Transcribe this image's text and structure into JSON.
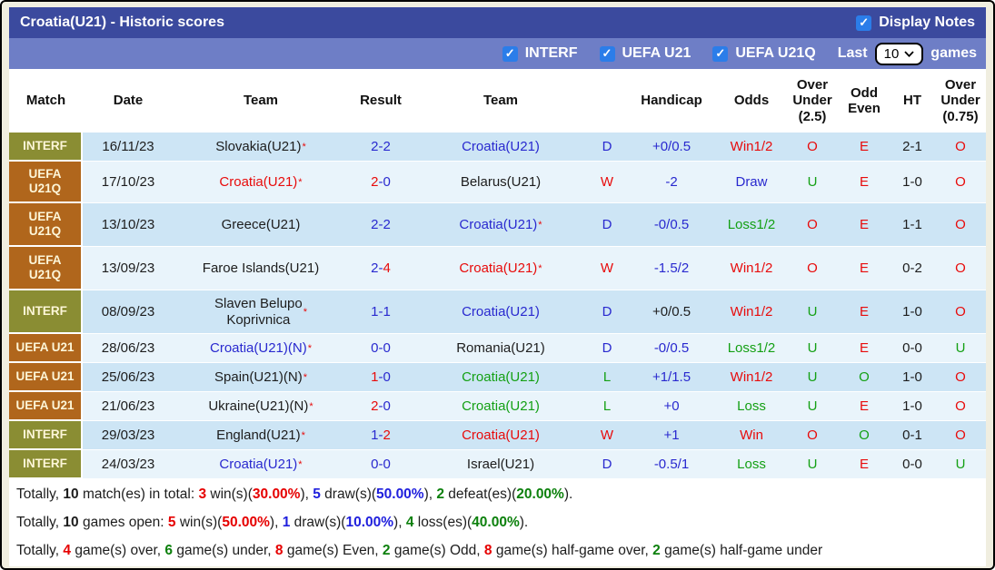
{
  "palette": {
    "bar1": "#3b4a9e",
    "bar2": "#6e7ec6",
    "beige": "#f0eee0",
    "row_dark": "#cde5f5",
    "row_light": "#e9f4fb",
    "olive": "#8a8d33",
    "brown": "#b0661c",
    "badge_text": "#fdf6d8",
    "red": "#e80b0b",
    "blue": "#2929cf",
    "green": "#14a014",
    "black": "#1d1d1d",
    "sum_red": "#e60000",
    "sum_blue": "#2020dd",
    "sum_green": "#0c800c",
    "checkbox_blue": "#2b7de9"
  },
  "icons": {
    "check": "✓",
    "star": "*"
  },
  "header": {
    "title": "Croatia(U21) - Historic scores",
    "display_notes_label": "Display Notes",
    "display_notes_checked": true
  },
  "filters": {
    "competitions": [
      {
        "label": "INTERF",
        "checked": true
      },
      {
        "label": "UEFA U21",
        "checked": true
      },
      {
        "label": "UEFA U21Q",
        "checked": true
      }
    ],
    "last_label": "Last",
    "last_value": "10",
    "games_label": "games"
  },
  "table": {
    "columns": [
      "Match",
      "Date",
      "Team",
      "Result",
      "Team",
      "",
      "Handicap",
      "Odds",
      "Over\nUnder\n(2.5)",
      "Odd\nEven",
      "HT",
      "Over\nUnder\n(0.75)"
    ],
    "rows": [
      {
        "comp": "INTERF",
        "comp_lines": "INTERF",
        "comp_color": "olive",
        "h": 32,
        "shade": "dark",
        "date": "16/11/23",
        "home": {
          "name": "Slovakia(U21)",
          "color": "black",
          "star": true
        },
        "score": [
          [
            "2",
            "blue"
          ],
          [
            "-",
            "blue"
          ],
          [
            "2",
            "blue"
          ]
        ],
        "away": {
          "name": "Croatia(U21)",
          "color": "blue",
          "star": false
        },
        "wdl": [
          "D",
          "blue"
        ],
        "handicap": [
          "+0/0.5",
          "blue"
        ],
        "odds": [
          "Win1/2",
          "red"
        ],
        "ou25": [
          "O",
          "red"
        ],
        "oe": [
          "E",
          "red"
        ],
        "ht": "2-1",
        "ou075": [
          "O",
          "red"
        ]
      },
      {
        "comp": "UEFA U21Q",
        "comp_lines": "UEFA\nU21Q",
        "comp_color": "brown",
        "h": 46,
        "shade": "light",
        "date": "17/10/23",
        "home": {
          "name": "Croatia(U21)",
          "color": "red",
          "star": true
        },
        "score": [
          [
            "2",
            "red"
          ],
          [
            "-",
            "blue"
          ],
          [
            "0",
            "blue"
          ]
        ],
        "away": {
          "name": "Belarus(U21)",
          "color": "black",
          "star": false
        },
        "wdl": [
          "W",
          "red"
        ],
        "handicap": [
          "-2",
          "blue"
        ],
        "odds": [
          "Draw",
          "blue"
        ],
        "ou25": [
          "U",
          "green"
        ],
        "oe": [
          "E",
          "red"
        ],
        "ht": "1-0",
        "ou075": [
          "O",
          "red"
        ]
      },
      {
        "comp": "UEFA U21Q",
        "comp_lines": "UEFA\nU21Q",
        "comp_color": "brown",
        "h": 48,
        "shade": "dark",
        "date": "13/10/23",
        "home": {
          "name": "Greece(U21)",
          "color": "black",
          "star": false
        },
        "score": [
          [
            "2",
            "blue"
          ],
          [
            "-",
            "blue"
          ],
          [
            "2",
            "blue"
          ]
        ],
        "away": {
          "name": "Croatia(U21)",
          "color": "blue",
          "star": true
        },
        "wdl": [
          "D",
          "blue"
        ],
        "handicap": [
          "-0/0.5",
          "blue"
        ],
        "odds": [
          "Loss1/2",
          "green"
        ],
        "ou25": [
          "O",
          "red"
        ],
        "oe": [
          "E",
          "red"
        ],
        "ht": "1-1",
        "ou075": [
          "O",
          "red"
        ]
      },
      {
        "comp": "UEFA U21Q",
        "comp_lines": "UEFA\nU21Q",
        "comp_color": "brown",
        "h": 48,
        "shade": "light",
        "date": "13/09/23",
        "home": {
          "name": "Faroe Islands(U21)",
          "color": "black",
          "star": false
        },
        "score": [
          [
            "2",
            "blue"
          ],
          [
            "-",
            "blue"
          ],
          [
            "4",
            "red"
          ]
        ],
        "away": {
          "name": "Croatia(U21)",
          "color": "red",
          "star": true
        },
        "wdl": [
          "W",
          "red"
        ],
        "handicap": [
          "-1.5/2",
          "blue"
        ],
        "odds": [
          "Win1/2",
          "red"
        ],
        "ou25": [
          "O",
          "red"
        ],
        "oe": [
          "E",
          "red"
        ],
        "ht": "0-2",
        "ou075": [
          "O",
          "red"
        ]
      },
      {
        "comp": "INTERF",
        "comp_lines": "INTERF",
        "comp_color": "olive",
        "h": 48,
        "shade": "dark",
        "date": "08/09/23",
        "home": {
          "name": "Slaven Belupo\nKoprivnica",
          "color": "black",
          "star": true
        },
        "score": [
          [
            "1",
            "blue"
          ],
          [
            "-",
            "blue"
          ],
          [
            "1",
            "blue"
          ]
        ],
        "away": {
          "name": "Croatia(U21)",
          "color": "blue",
          "star": false
        },
        "wdl": [
          "D",
          "blue"
        ],
        "handicap": [
          "+0/0.5",
          "black"
        ],
        "odds": [
          "Win1/2",
          "red"
        ],
        "ou25": [
          "U",
          "green"
        ],
        "oe": [
          "E",
          "red"
        ],
        "ht": "1-0",
        "ou075": [
          "O",
          "red"
        ]
      },
      {
        "comp": "UEFA U21",
        "comp_lines": "UEFA U21",
        "comp_color": "brown",
        "h": 32,
        "shade": "light",
        "date": "28/06/23",
        "home": {
          "name": "Croatia(U21)(N)",
          "color": "blue",
          "star": true
        },
        "score": [
          [
            "0",
            "blue"
          ],
          [
            "-",
            "blue"
          ],
          [
            "0",
            "blue"
          ]
        ],
        "away": {
          "name": "Romania(U21)",
          "color": "black",
          "star": false
        },
        "wdl": [
          "D",
          "blue"
        ],
        "handicap": [
          "-0/0.5",
          "blue"
        ],
        "odds": [
          "Loss1/2",
          "green"
        ],
        "ou25": [
          "U",
          "green"
        ],
        "oe": [
          "E",
          "red"
        ],
        "ht": "0-0",
        "ou075": [
          "U",
          "green"
        ]
      },
      {
        "comp": "UEFA U21",
        "comp_lines": "UEFA U21",
        "comp_color": "brown",
        "h": 32,
        "shade": "dark",
        "date": "25/06/23",
        "home": {
          "name": "Spain(U21)(N)",
          "color": "black",
          "star": true
        },
        "score": [
          [
            "1",
            "red"
          ],
          [
            "-",
            "blue"
          ],
          [
            "0",
            "blue"
          ]
        ],
        "away": {
          "name": "Croatia(U21)",
          "color": "green",
          "star": false
        },
        "wdl": [
          "L",
          "green"
        ],
        "handicap": [
          "+1/1.5",
          "blue"
        ],
        "odds": [
          "Win1/2",
          "red"
        ],
        "ou25": [
          "U",
          "green"
        ],
        "oe": [
          "O",
          "green"
        ],
        "ht": "1-0",
        "ou075": [
          "O",
          "red"
        ]
      },
      {
        "comp": "UEFA U21",
        "comp_lines": "UEFA U21",
        "comp_color": "brown",
        "h": 32,
        "shade": "light",
        "date": "21/06/23",
        "home": {
          "name": "Ukraine(U21)(N)",
          "color": "black",
          "star": true
        },
        "score": [
          [
            "2",
            "red"
          ],
          [
            "-",
            "blue"
          ],
          [
            "0",
            "blue"
          ]
        ],
        "away": {
          "name": "Croatia(U21)",
          "color": "green",
          "star": false
        },
        "wdl": [
          "L",
          "green"
        ],
        "handicap": [
          "+0",
          "blue"
        ],
        "odds": [
          "Loss",
          "green"
        ],
        "ou25": [
          "U",
          "green"
        ],
        "oe": [
          "E",
          "red"
        ],
        "ht": "1-0",
        "ou075": [
          "O",
          "red"
        ]
      },
      {
        "comp": "INTERF",
        "comp_lines": "INTERF",
        "comp_color": "olive",
        "h": 32,
        "shade": "dark",
        "date": "29/03/23",
        "home": {
          "name": "England(U21)",
          "color": "black",
          "star": true
        },
        "score": [
          [
            "1",
            "blue"
          ],
          [
            "-",
            "blue"
          ],
          [
            "2",
            "red"
          ]
        ],
        "away": {
          "name": "Croatia(U21)",
          "color": "red",
          "star": false
        },
        "wdl": [
          "W",
          "red"
        ],
        "handicap": [
          "+1",
          "blue"
        ],
        "odds": [
          "Win",
          "red"
        ],
        "ou25": [
          "O",
          "red"
        ],
        "oe": [
          "O",
          "green"
        ],
        "ht": "0-1",
        "ou075": [
          "O",
          "red"
        ]
      },
      {
        "comp": "INTERF",
        "comp_lines": "INTERF",
        "comp_color": "olive",
        "h": 32,
        "shade": "light",
        "date": "24/03/23",
        "home": {
          "name": "Croatia(U21)",
          "color": "blue",
          "star": true
        },
        "score": [
          [
            "0",
            "blue"
          ],
          [
            "-",
            "blue"
          ],
          [
            "0",
            "blue"
          ]
        ],
        "away": {
          "name": "Israel(U21)",
          "color": "black",
          "star": false
        },
        "wdl": [
          "D",
          "blue"
        ],
        "handicap": [
          "-0.5/1",
          "blue"
        ],
        "odds": [
          "Loss",
          "green"
        ],
        "ou25": [
          "U",
          "green"
        ],
        "oe": [
          "E",
          "red"
        ],
        "ht": "0-0",
        "ou075": [
          "U",
          "green"
        ]
      }
    ]
  },
  "summary": [
    [
      {
        "t": "Totally, ",
        "c": "black"
      },
      {
        "t": "10",
        "c": "black",
        "b": 1
      },
      {
        "t": " match(es) in total: ",
        "c": "black"
      },
      {
        "t": "3",
        "c": "sum_red",
        "b": 1
      },
      {
        "t": " win(s)(",
        "c": "black"
      },
      {
        "t": "30.00%",
        "c": "sum_red",
        "b": 1
      },
      {
        "t": "), ",
        "c": "black"
      },
      {
        "t": "5",
        "c": "sum_blue",
        "b": 1
      },
      {
        "t": " draw(s)(",
        "c": "black"
      },
      {
        "t": "50.00%",
        "c": "sum_blue",
        "b": 1
      },
      {
        "t": "), ",
        "c": "black"
      },
      {
        "t": "2",
        "c": "sum_green",
        "b": 1
      },
      {
        "t": " defeat(es)(",
        "c": "black"
      },
      {
        "t": "20.00%",
        "c": "sum_green",
        "b": 1
      },
      {
        "t": ").",
        "c": "black"
      }
    ],
    [
      {
        "t": "Totally, ",
        "c": "black"
      },
      {
        "t": "10",
        "c": "black",
        "b": 1
      },
      {
        "t": " games open: ",
        "c": "black"
      },
      {
        "t": "5",
        "c": "sum_red",
        "b": 1
      },
      {
        "t": " win(s)(",
        "c": "black"
      },
      {
        "t": "50.00%",
        "c": "sum_red",
        "b": 1
      },
      {
        "t": "), ",
        "c": "black"
      },
      {
        "t": "1",
        "c": "sum_blue",
        "b": 1
      },
      {
        "t": " draw(s)(",
        "c": "black"
      },
      {
        "t": "10.00%",
        "c": "sum_blue",
        "b": 1
      },
      {
        "t": "), ",
        "c": "black"
      },
      {
        "t": "4",
        "c": "sum_green",
        "b": 1
      },
      {
        "t": " loss(es)(",
        "c": "black"
      },
      {
        "t": "40.00%",
        "c": "sum_green",
        "b": 1
      },
      {
        "t": ").",
        "c": "black"
      }
    ],
    [
      {
        "t": "Totally, ",
        "c": "black"
      },
      {
        "t": "4",
        "c": "sum_red",
        "b": 1
      },
      {
        "t": " game(s) over, ",
        "c": "black"
      },
      {
        "t": "6",
        "c": "sum_green",
        "b": 1
      },
      {
        "t": " game(s) under, ",
        "c": "black"
      },
      {
        "t": "8",
        "c": "sum_red",
        "b": 1
      },
      {
        "t": " game(s) Even, ",
        "c": "black"
      },
      {
        "t": "2",
        "c": "sum_green",
        "b": 1
      },
      {
        "t": " game(s) Odd, ",
        "c": "black"
      },
      {
        "t": "8",
        "c": "sum_red",
        "b": 1
      },
      {
        "t": " game(s) half-game over, ",
        "c": "black"
      },
      {
        "t": "2",
        "c": "sum_green",
        "b": 1
      },
      {
        "t": " game(s) half-game under",
        "c": "black"
      }
    ]
  ]
}
